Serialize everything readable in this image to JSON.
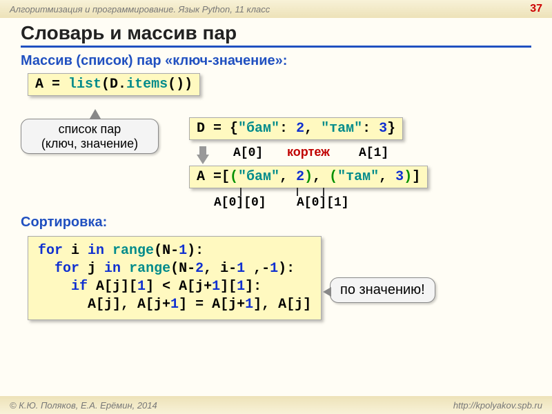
{
  "header": {
    "course": "Алгоритмизация и программирование. Язык Python, 11 класс",
    "page": "37"
  },
  "title": "Словарь и массив пар",
  "subtitle1": "Массив (список) пар «ключ-значение»:",
  "code1": {
    "A": "A",
    "eq": " = ",
    "list": "list",
    "open": "(D.",
    "items": "items",
    "close": "())"
  },
  "bubble1_line1": "список пар",
  "bubble1_line2": "(ключ, значение)",
  "code2": {
    "D": "D",
    "eq": " = {",
    "k1": "\"бам\"",
    "c1": ": ",
    "v1": "2",
    "comma": ", ",
    "k2": "\"там\"",
    "c2": ": ",
    "v2": "3",
    "end": "}"
  },
  "labels": {
    "a0": "A[0]",
    "a1": "A[1]",
    "tuple": "кортеж",
    "a00": "A[0][0]",
    "a01": "A[0][1]"
  },
  "code3": {
    "A": "A",
    "eq": " =[",
    "p1o": "(",
    "p1k": "\"бам\"",
    "p1c": ", ",
    "p1v": "2",
    "p1e": ")",
    "comma": ", ",
    "p2o": "(",
    "p2k": "\"там\"",
    "p2c": ", ",
    "p2v": "3",
    "p2e": ")",
    "end": "]"
  },
  "subtitle2": "Сортировка:",
  "code4": {
    "l1_for": "for",
    "l1_mid": " i ",
    "l1_in": "in",
    "l1_range": " range",
    "l1_open": "(N-",
    "l1_n1": "1",
    "l1_close": "):",
    "l2_for": "for",
    "l2_mid": " j ",
    "l2_in": "in",
    "l2_range": " range",
    "l2_open": "(N-",
    "l2_n2": "2",
    "l2_c": ", i-",
    "l2_n1": "1",
    "l2_c2": " ,-",
    "l2_nm1": "1",
    "l2_close": "):",
    "l3_if": "if",
    "l3_body": " A[j][",
    "l3_i1": "1",
    "l3_b2": "] < A[j+",
    "l3_i2": "1",
    "l3_b3": "][",
    "l3_i3": "1",
    "l3_b4": "]:",
    "l4": "A[j], A[j+",
    "l4_i1": "1",
    "l4_m": "] = A[j+",
    "l4_i2": "1",
    "l4_e": "], A[j]"
  },
  "bubble2": "по значению!",
  "footer": {
    "left": "© К.Ю. Поляков, Е.А. Ерёмин, 2014",
    "right": "http://kpolyakov.spb.ru"
  }
}
